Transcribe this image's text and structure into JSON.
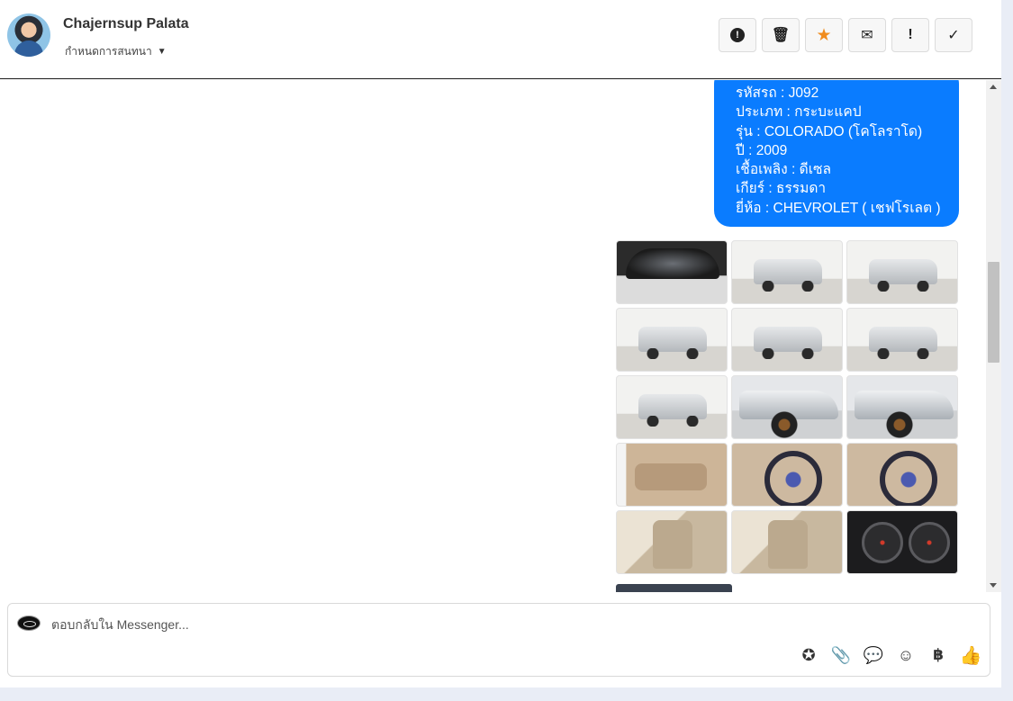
{
  "header": {
    "contact_name": "Chajernsup Palata",
    "conversation_status": "กำหนดการสนทนา",
    "toolbar": [
      {
        "name": "report-button",
        "icon": "alert-circle-icon",
        "glyph": "!"
      },
      {
        "name": "delete-button",
        "icon": "trash-icon",
        "glyph": "🗑"
      },
      {
        "name": "star-button",
        "icon": "star-icon",
        "glyph": "★"
      },
      {
        "name": "mark-unread-button",
        "icon": "envelope-icon",
        "glyph": "✉"
      },
      {
        "name": "flag-button",
        "icon": "exclamation-icon",
        "glyph": "!"
      },
      {
        "name": "mark-done-button",
        "icon": "check-icon",
        "glyph": "✓"
      }
    ]
  },
  "message": {
    "lines": [
      "รหัสรถ : J092",
      "ประเภท : กระบะแคป",
      "รุ่น : COLORADO (โคโลราโด)",
      "ปี : 2009",
      "เชื้อเพลิง : ดีเซล",
      "เกียร์ : ธรรมดา",
      "ยี่ห้อ : CHEVROLET ( เชฟโรเลต )"
    ],
    "bubble_color": "#0a7cff"
  },
  "gallery": {
    "photos": [
      {
        "kind": "engine"
      },
      {
        "kind": "truck"
      },
      {
        "kind": "truck"
      },
      {
        "kind": "truck"
      },
      {
        "kind": "truck"
      },
      {
        "kind": "truck"
      },
      {
        "kind": "truck"
      },
      {
        "kind": "side"
      },
      {
        "kind": "side"
      },
      {
        "kind": "door"
      },
      {
        "kind": "wheel"
      },
      {
        "kind": "wheel"
      },
      {
        "kind": "seat"
      },
      {
        "kind": "seat"
      },
      {
        "kind": "gauge"
      }
    ]
  },
  "reply": {
    "placeholder": "ตอบกลับใน Messenger...",
    "tools": [
      {
        "name": "saved-reply-button",
        "icon": "chat-star-icon",
        "glyph": "✪"
      },
      {
        "name": "attach-button",
        "icon": "paperclip-icon",
        "glyph": "📎"
      },
      {
        "name": "quick-reply-button",
        "icon": "chat-dots-icon",
        "glyph": "💬"
      },
      {
        "name": "emoji-button",
        "icon": "smiley-icon",
        "glyph": "☺"
      },
      {
        "name": "payment-button",
        "icon": "baht-icon",
        "glyph": "฿"
      },
      {
        "name": "like-button",
        "icon": "thumbs-up-icon",
        "glyph": "👍"
      }
    ]
  },
  "colors": {
    "accent": "#0a7cff",
    "star": "#f08c1e",
    "background": "#e9edf6"
  }
}
